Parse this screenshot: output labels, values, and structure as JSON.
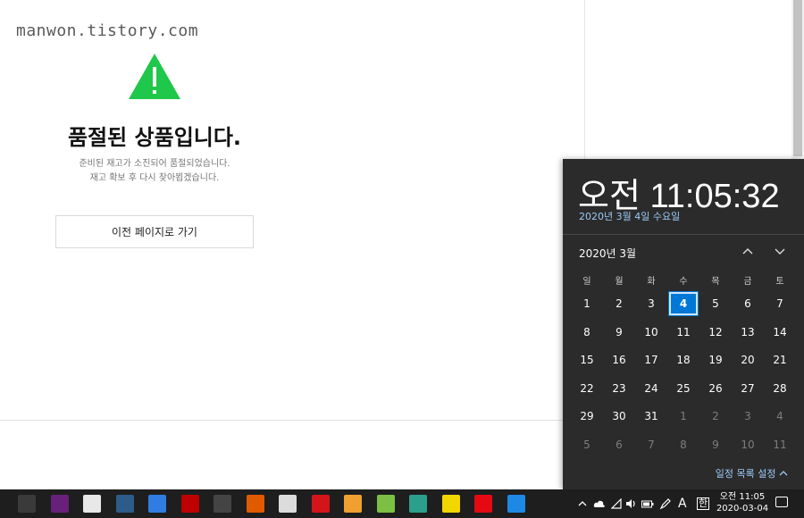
{
  "watermark": "manwon.tistory.com",
  "page": {
    "title": "품절된 상품입니다.",
    "desc_line1": "준비된 재고가 소진되어 품절되었습니다.",
    "desc_line2": "재고 확보 후 다시 찾아뵙겠습니다.",
    "back_button": "이전 페이지로 가기",
    "warning_icon_color": "#1fc74a"
  },
  "clock_flyout": {
    "time": "오전 11:05:32",
    "date": "2020년 3월 4일 수요일",
    "month_label": "2020년 3월",
    "up_icon": "chevron-up-icon",
    "down_icon": "chevron-down-icon",
    "weekdays": [
      "일",
      "월",
      "화",
      "수",
      "목",
      "금",
      "토"
    ],
    "weeks": [
      [
        "1",
        "2",
        "3",
        "4",
        "5",
        "6",
        "7"
      ],
      [
        "8",
        "9",
        "10",
        "11",
        "12",
        "13",
        "14"
      ],
      [
        "15",
        "16",
        "17",
        "18",
        "19",
        "20",
        "21"
      ],
      [
        "22",
        "23",
        "24",
        "25",
        "26",
        "27",
        "28"
      ],
      [
        "29",
        "30",
        "31",
        "1",
        "2",
        "3",
        "4"
      ],
      [
        "5",
        "6",
        "7",
        "8",
        "9",
        "10",
        "11"
      ]
    ],
    "today": "4",
    "agenda_toggle": "일정 목록 설정",
    "accent_color": "#0078d7"
  },
  "taskbar": {
    "apps": [
      {
        "name": "terminal-icon",
        "color": "#3a3a3a"
      },
      {
        "name": "visual-studio-icon",
        "color": "#68217a"
      },
      {
        "name": "unity-icon",
        "color": "#e8e8e8"
      },
      {
        "name": "monitor-app-icon",
        "color": "#2d5b8a"
      },
      {
        "name": "v-app-icon",
        "color": "#2f7de1"
      },
      {
        "name": "filezilla-icon",
        "color": "#bf0000"
      },
      {
        "name": "media-player-icon",
        "color": "#444444"
      },
      {
        "name": "globe-app-icon",
        "color": "#e05a00"
      },
      {
        "name": "s-app-icon",
        "color": "#dcdcdc"
      },
      {
        "name": "acrobat-icon",
        "color": "#d4141b"
      },
      {
        "name": "photo-app-icon",
        "color": "#f0a030"
      },
      {
        "name": "android-icon",
        "color": "#7bc043"
      },
      {
        "name": "curve-app-icon",
        "color": "#2b9f8c"
      },
      {
        "name": "sticky-notes-icon",
        "color": "#f2d600"
      },
      {
        "name": "netflix-icon",
        "color": "#e50914"
      },
      {
        "name": "mail-icon",
        "color": "#1e88e5"
      }
    ],
    "tray_chevron": "^",
    "ime_label": "A",
    "ime_hangul": "한",
    "clock_time": "오전 11:05",
    "clock_date": "2020-03-04"
  }
}
